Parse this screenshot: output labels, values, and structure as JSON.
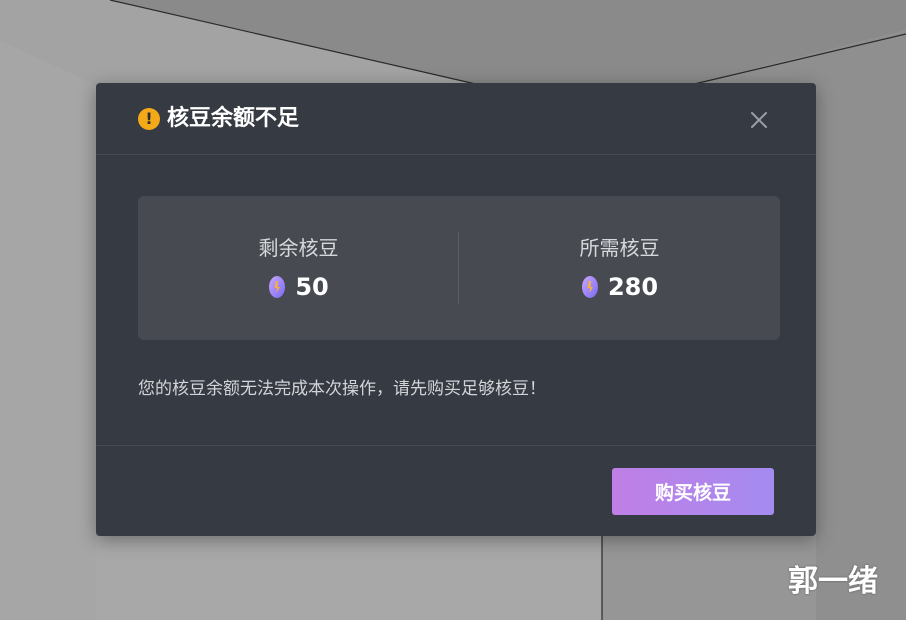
{
  "dialog": {
    "title": "核豆余额不足",
    "warning_icon": "exclamation-icon",
    "close_icon": "close-icon",
    "remaining": {
      "label": "剩余核豆",
      "value": "50"
    },
    "required": {
      "label": "所需核豆",
      "value": "280"
    },
    "bean_icon": "bean-coin-icon",
    "message": "您的核豆余额无法完成本次操作，请先购买足够核豆！",
    "buy_button_label": "购买核豆"
  },
  "watermark": "郭一绪",
  "colors": {
    "dialog_bg": "#363a42",
    "card_bg": "#474a51",
    "warning": "#f4a918",
    "button_gradient_start": "#c07fe6",
    "button_gradient_end": "#a48bf0"
  }
}
